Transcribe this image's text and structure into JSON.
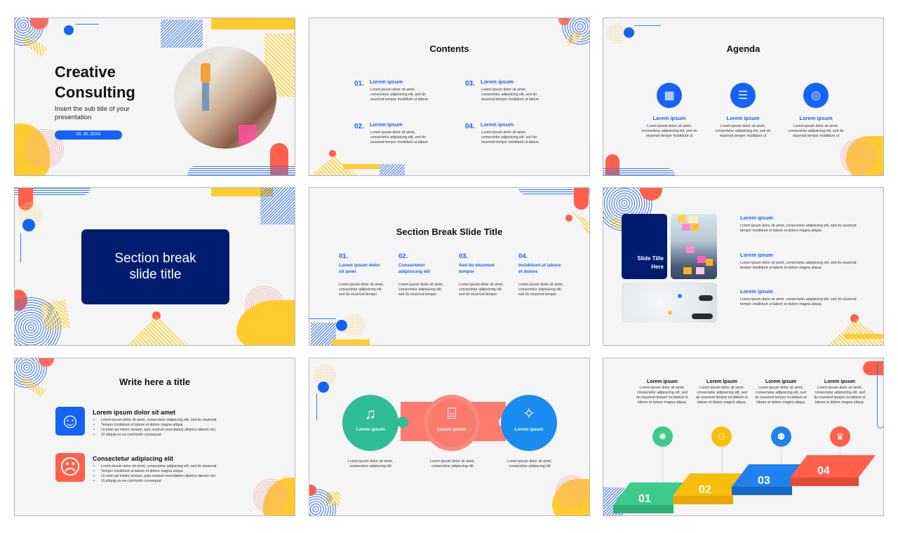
{
  "colors": {
    "primary_blue": "#1463f3",
    "navy": "#001c6e",
    "coral": "#ff5f4b",
    "yellow": "#ffcb2f",
    "green": "#3ccb8a",
    "slide_bg": "#f5f5f5"
  },
  "slides": [
    {
      "id": 1,
      "title_line1": "Creative",
      "title_line2": "Consulting",
      "subtitle": "Insert the sub title of your presentation",
      "date": "00. 00. 20XX"
    },
    {
      "id": 2,
      "title": "Contents",
      "items": [
        {
          "num": "01.",
          "heading": "Lorem ipsum",
          "body": "Lorem ipsum dolor sit amet, consectetur adipisicing elit, sed do eiusmod tempor incididunt ut labore"
        },
        {
          "num": "02.",
          "heading": "Lorem ipsum",
          "body": "Lorem ipsum dolor sit amet, consectetur adipisicing elit, sed do eiusmod tempor incididunt ut labore"
        },
        {
          "num": "03.",
          "heading": "Lorem ipsum",
          "body": "Lorem ipsum dolor sit amet, consectetur adipisicing elit, sed do eiusmod tempor incididunt ut labore"
        },
        {
          "num": "04.",
          "heading": "Lorem ipsum",
          "body": "Lorem ipsum dolor sit amet, consectetur adipisicing elit, sed do eiusmod tempor incididunt ut labore"
        }
      ]
    },
    {
      "id": 3,
      "title": "Agenda",
      "items": [
        {
          "icon": "calendar-icon",
          "glyph": "▦",
          "heading": "Lorem ipsum",
          "body": "Lorem ipsum dolor sit amet, consectetur adipisicing elit, sed do eiusmod tempor incididunt ut"
        },
        {
          "icon": "checklist-icon",
          "glyph": "☰",
          "heading": "Lorem ipsum",
          "body": "Lorem ipsum dolor sit amet, consectetur adipisicing elit, sed do eiusmod tempor incididunt ut"
        },
        {
          "icon": "target-icon",
          "glyph": "◎",
          "heading": "Lorem ipsum",
          "body": "Lorem ipsum dolor sit amet, consectetur adipisicing elit, sed do eiusmod tempor incididunt ut"
        }
      ]
    },
    {
      "id": 4,
      "title_line1": "Section break",
      "title_line2": "slide title"
    },
    {
      "id": 5,
      "title": "Section Break Slide Title",
      "items": [
        {
          "num": "01.",
          "heading": "Lorem ipsum dolor sit amet",
          "body": "Lorem ipsum dolor sit amet, consectetur adipisicing elit, sed do eiusmod tempor"
        },
        {
          "num": "02.",
          "heading": "Consectetur adipisicing elit",
          "body": "Lorem ipsum dolor sit amet, consectetur adipisicing elit, sed do eiusmod tempor"
        },
        {
          "num": "03.",
          "heading": "Sed do eiusmod tempor",
          "body": "Lorem ipsum dolor sit amet, consectetur adipisicing elit, sed do eiusmod tempor"
        },
        {
          "num": "04.",
          "heading": "Incididunt ut labore et dolore",
          "body": "Lorem ipsum dolor sit amet, consectetur adipisicing elit, sed do eiusmod tempor"
        }
      ]
    },
    {
      "id": 6,
      "card_title": "Slide Title Here",
      "items": [
        {
          "heading": "Lorem ipsum",
          "body": "Lorem ipsum dolor sit amet, consectetur adipisicing elit, sed do eiusmod tempor incididunt ut labore et dolore magna aliqua."
        },
        {
          "heading": "Lorem ipsum",
          "body": "Lorem ipsum dolor sit amet, consectetur adipisicing elit, sed do eiusmod tempor incididunt ut labore et dolore magna aliqua."
        },
        {
          "heading": "Lorem ipsum",
          "body": "Lorem ipsum dolor sit amet, consectetur adipisicing elit, sed do eiusmod tempor incididunt ut labore et dolore magna aliqua."
        }
      ]
    },
    {
      "id": 7,
      "title": "Write here a title",
      "blocks": [
        {
          "icon": "smiley-happy-icon",
          "glyph": "☺",
          "heading": "Lorem ipsum dolor sit amet",
          "bullets": [
            "Lorem ipsum dolor sit amet, consectetur adipiscing elit, sed do eiusmod",
            "Tempor incididunt ut labore et dolore magna aliqua",
            "Ut enim ad minim veniam, quis nostrud exercitation ullamco laboris nisi",
            "Ut aliquip ex ea commodo consequat."
          ]
        },
        {
          "icon": "smiley-sad-icon",
          "glyph": "☹",
          "heading": "Consectetur adipiscing elit",
          "bullets": [
            "Lorem ipsum dolor sit amet, consectetur adipiscing elit, sed do eiusmod",
            "Tempor incididunt ut labore et dolore magna aliqua",
            "Ut enim ad minim veniam, quis nostrud exercitation ullamco laboris nisi",
            "Ut aliquip ex ea commodo consequat."
          ]
        }
      ]
    },
    {
      "id": 8,
      "items": [
        {
          "icon": "music-player-icon",
          "glyph": "♫",
          "label": "Lorem ipsum",
          "body": "Lorem ipsum dolor sit amet, consectetur adipiscing elit"
        },
        {
          "icon": "camera-icon",
          "glyph": "⌸",
          "label": "Lorem ipsum",
          "body": "Lorem ipsum dolor sit amet, consectetur adipiscing elit"
        },
        {
          "icon": "party-popper-icon",
          "glyph": "✧",
          "label": "Lorem ipsum",
          "body": "Lorem ipsum dolor sit amet, consectetur adipiscing elit"
        }
      ]
    },
    {
      "id": 9,
      "steps": [
        {
          "num": "01",
          "icon": "lightbulb-icon",
          "glyph": "✺",
          "heading": "Lorem ipsum",
          "body": "Lorem ipsum dolor sit amet, consectetur adipisicing elit, sed do eiusmod tempor incididunt ut labore et dolore magna aliqua."
        },
        {
          "num": "02",
          "icon": "network-icon",
          "glyph": "⚇",
          "heading": "Lorem ipsum",
          "body": "Lorem ipsum dolor sit amet, consectetur adipisicing elit, sed do eiusmod tempor incididunt ut labore et dolore magna aliqua."
        },
        {
          "num": "03",
          "icon": "team-icon",
          "glyph": "⚉",
          "heading": "Lorem ipsum",
          "body": "Lorem ipsum dolor sit amet, consectetur adipisicing elit, sed do eiusmod tempor incididunt ut labore et dolore magna aliqua."
        },
        {
          "num": "04",
          "icon": "trophy-icon",
          "glyph": "♛",
          "heading": "Lorem ipsum",
          "body": "Lorem ipsum dolor sit amet, consectetur adipisicing elit, sed do eiusmod tempor incididunt ut labore et dolore magna aliqua."
        }
      ]
    }
  ]
}
